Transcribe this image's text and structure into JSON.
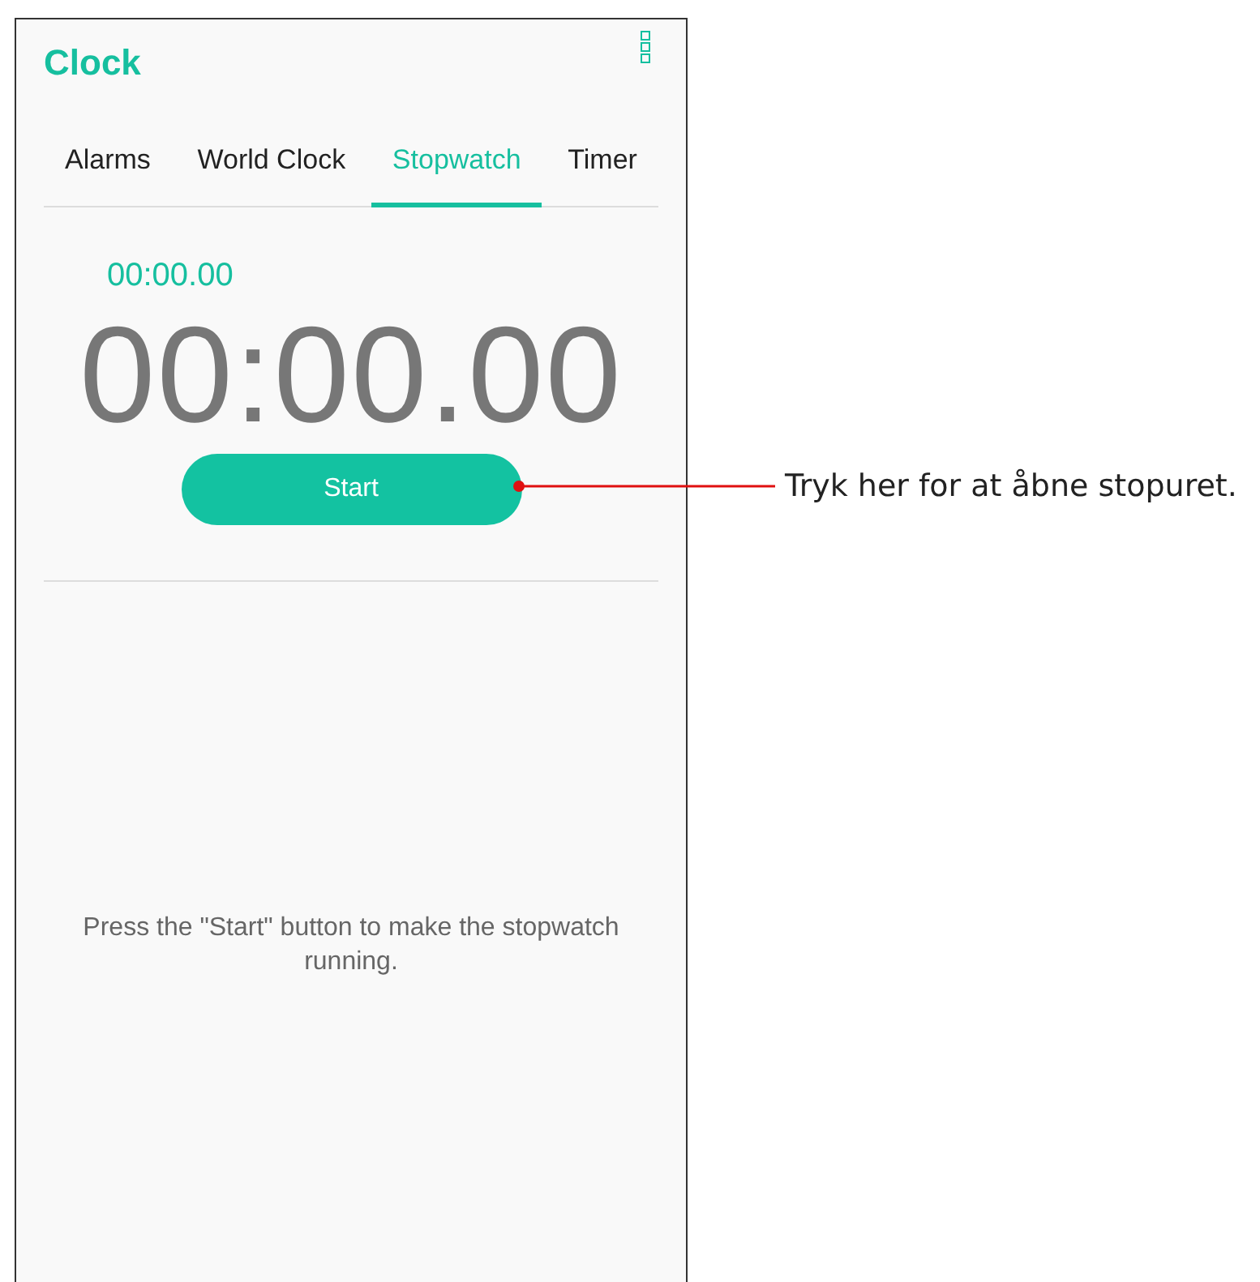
{
  "app_bar": {
    "title": "Clock"
  },
  "tabs": [
    {
      "label": "Alarms",
      "selected": false
    },
    {
      "label": "World Clock",
      "selected": false
    },
    {
      "label": "Stopwatch",
      "selected": true
    },
    {
      "label": "Timer",
      "selected": false
    }
  ],
  "stopwatch": {
    "lap_time": "00:00.00",
    "time": "00:00.00",
    "start_button": "Start"
  },
  "hint": "Press the \"Start\" button to make the stopwatch running.",
  "callout": {
    "text": "Tryk her for at åbne stopuret."
  }
}
